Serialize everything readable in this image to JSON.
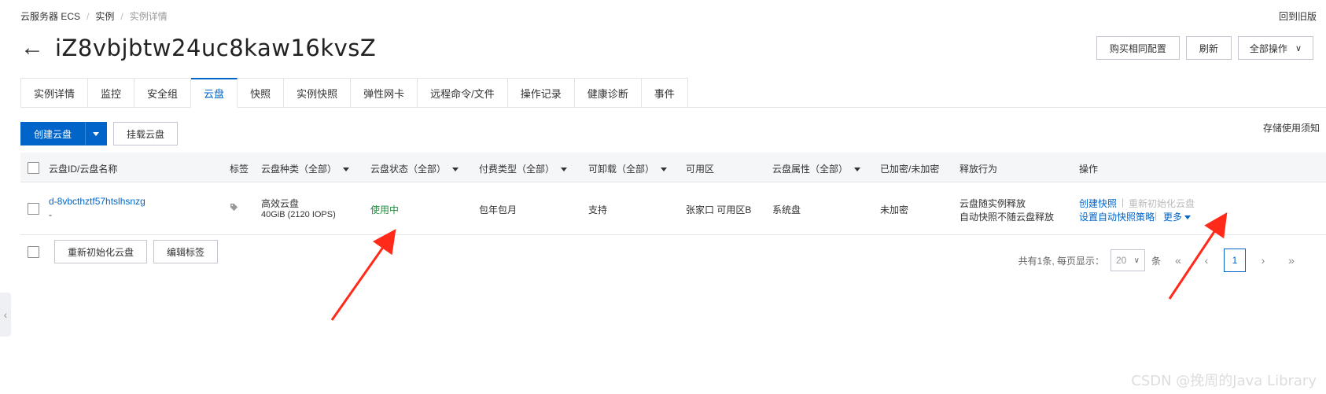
{
  "breadcrumb": {
    "items": [
      "云服务器 ECS",
      "实例",
      "实例详情"
    ]
  },
  "back_to_old": "回到旧版",
  "title": "iZ8vbjbtw24uc8kaw16kvsZ",
  "top_actions": {
    "buy_same": "购买相同配置",
    "refresh": "刷新",
    "all_ops": "全部操作"
  },
  "tabs": [
    "实例详情",
    "监控",
    "安全组",
    "云盘",
    "快照",
    "实例快照",
    "弹性网卡",
    "远程命令/文件",
    "操作记录",
    "健康诊断",
    "事件"
  ],
  "active_tab": "云盘",
  "toolbar": {
    "create_disk": "创建云盘",
    "mount_disk": "挂载云盘"
  },
  "storage_note": "存储使用须知",
  "table": {
    "headers": {
      "id_name": "云盘ID/云盘名称",
      "tag": "标签",
      "type": "云盘种类（全部）",
      "status": "云盘状态（全部）",
      "billing": "付费类型（全部）",
      "detachable": "可卸载（全部）",
      "zone": "可用区",
      "attribute": "云盘属性（全部）",
      "encrypted": "已加密/未加密",
      "release": "释放行为",
      "ops": "操作"
    },
    "rows": [
      {
        "id": "d-8vbcthztf57htslhsnzg",
        "name": "-",
        "type": "高效云盘",
        "spec": "40GiB (2120 IOPS)",
        "status": "使用中",
        "billing": "包年包月",
        "detachable": "支持",
        "zone": "张家口 可用区B",
        "attribute": "系统盘",
        "encrypted": "未加密",
        "release_1": "云盘随实例释放",
        "release_2": "自动快照不随云盘释放",
        "op_create_snapshot": "创建快照",
        "op_reinit": "重新初始化云盘",
        "op_auto_snapshot": "设置自动快照策略",
        "op_more": "更多"
      }
    ]
  },
  "footer": {
    "reinit_disk": "重新初始化云盘",
    "edit_tags": "编辑标签"
  },
  "pagination": {
    "summary": "共有1条, 每页显示：",
    "page_size": "20",
    "unit": "条",
    "current_page": "1"
  },
  "watermark": "CSDN @挽周的Java Library",
  "colors": {
    "primary": "#0064c8",
    "status_ok": "#1e8e3e",
    "annotation_arrow": "#ff2a1a"
  }
}
